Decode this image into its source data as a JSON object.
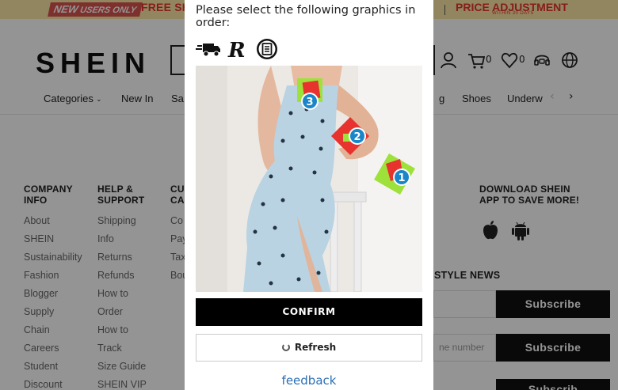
{
  "promo": {
    "new_prefix": "NEW",
    "new_suffix": "USERS ONLY",
    "free_shipping": "FREE SH",
    "price_adjustment": "PRICE ADJUSTMENT",
    "within": "WITHIN 30 DAYS"
  },
  "header": {
    "logo": "SHEIN",
    "cart_count": "0",
    "wishlist_count": "0"
  },
  "nav": {
    "items": [
      "Categories",
      "New In",
      "Sa",
      "g",
      "Shoes",
      "Underw"
    ]
  },
  "footer": {
    "columns": [
      {
        "heading_line1": "COMPANY",
        "heading_line2": "INFO",
        "links": [
          "About",
          "SHEIN",
          "Sustainability",
          "Fashion",
          "Blogger",
          "Supply",
          "Chain",
          "Careers",
          "Student",
          "Discount"
        ]
      },
      {
        "heading_line1": "HELP &",
        "heading_line2": "SUPPORT",
        "links": [
          "Shipping",
          "Info",
          "Returns",
          "Refunds",
          "How to",
          "Order",
          "How to",
          "Track",
          "Size Guide",
          "SHEIN VIP"
        ]
      },
      {
        "heading_line1": "CU",
        "heading_line2": "CA",
        "links": [
          "Co",
          "Pay",
          "Tax",
          "Bou"
        ]
      }
    ],
    "app_heading_line1": "DOWNLOAD SHEIN",
    "app_heading_line2": "APP TO SAVE MORE!",
    "style_news": "STYLE NEWS",
    "phone_placeholder": "ne number",
    "subscribe_1": "Subscribe",
    "subscribe_2": "Subscribe",
    "subscribe_3": "Subscrib"
  },
  "captcha": {
    "prompt": "Please select the following graphics in order:",
    "hint_icons": [
      "delivery-truck-icon",
      "registered-r-icon",
      "document-circle-icon"
    ],
    "markers": [
      "1",
      "2",
      "3"
    ],
    "confirm_label": "CONFIRM",
    "refresh_label": "Refresh",
    "feedback_label": "feedback"
  },
  "colors": {
    "promo_bg": "#fbe7a6",
    "promo_red": "#e8322e",
    "marker_blue": "#1a86c9",
    "confirm_bg": "#000000",
    "feedback_link": "#2a6fb5"
  }
}
